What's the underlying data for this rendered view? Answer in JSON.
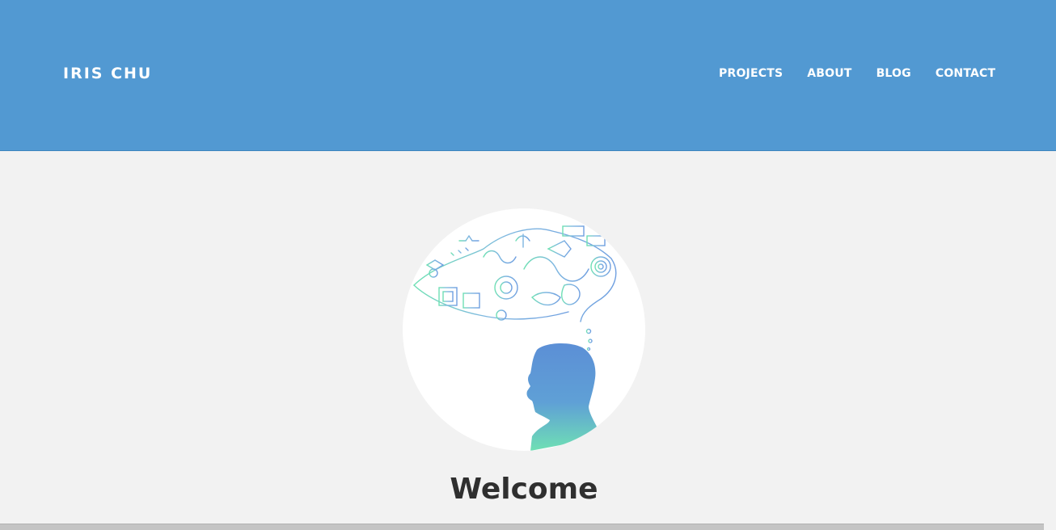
{
  "header": {
    "brand": "IRIS CHU",
    "nav": [
      {
        "label": "PROJECTS"
      },
      {
        "label": "ABOUT"
      },
      {
        "label": "BLOG"
      },
      {
        "label": "CONTACT"
      }
    ]
  },
  "hero": {
    "image": "profile-illustration",
    "heading": "Welcome"
  },
  "colors": {
    "header_bg": "#5299d2",
    "page_bg": "#f2f2f2",
    "heading_text": "#2f2f2f",
    "illustration_blue": "#5c8fd6",
    "illustration_green": "#6fe0b4"
  }
}
